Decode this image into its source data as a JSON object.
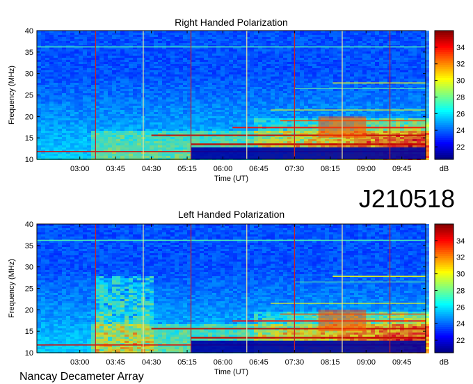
{
  "chart_data": [
    {
      "type": "heatmap",
      "title": "Right Handed Polarization",
      "xlabel": "Time (UT)",
      "ylabel": "Frequency (MHz)",
      "x_tick_labels": [
        "03:00",
        "03:45",
        "04:30",
        "05:15",
        "06:00",
        "06:45",
        "07:30",
        "08:15",
        "09:00",
        "09:45"
      ],
      "x_ticks_hours": [
        3.0,
        3.75,
        4.5,
        5.25,
        6.0,
        6.75,
        7.5,
        8.25,
        9.0,
        9.75
      ],
      "xlim_hours": [
        2.1,
        10.25
      ],
      "ylim": [
        10,
        40
      ],
      "y_ticks": [
        10,
        15,
        20,
        25,
        30,
        35,
        40
      ],
      "colorbar": {
        "label": "dB",
        "ticks": [
          22,
          24,
          26,
          28,
          30,
          32,
          34
        ],
        "range": [
          20.5,
          36
        ]
      },
      "vertical_markers_hours": [
        3.33,
        4.33,
        5.33,
        6.5,
        7.5,
        8.5,
        9.5
      ],
      "emission_features": [
        {
          "desc": "persistent interference line",
          "freq_mhz": 36,
          "level_db": 27
        },
        {
          "desc": "low-frequency band activity",
          "freq_mhz": [
            10,
            20
          ],
          "time_hours": [
            7.0,
            10.25
          ],
          "level_db": 33
        },
        {
          "desc": "drifting burst",
          "freq_mhz": [
            17,
            24
          ],
          "time_hours": [
            6.5,
            6.9
          ],
          "level_db": 32
        }
      ]
    },
    {
      "type": "heatmap",
      "title": "Left Handed Polarization",
      "xlabel": "Time (UT)",
      "ylabel": "Frequency (MHz)",
      "x_tick_labels": [
        "03:00",
        "03:45",
        "04:30",
        "05:15",
        "06:00",
        "06:45",
        "07:30",
        "08:15",
        "09:00",
        "09:45"
      ],
      "x_ticks_hours": [
        3.0,
        3.75,
        4.5,
        5.25,
        6.0,
        6.75,
        7.5,
        8.25,
        9.0,
        9.75
      ],
      "xlim_hours": [
        2.1,
        10.25
      ],
      "ylim": [
        10,
        40
      ],
      "y_ticks": [
        10,
        15,
        20,
        25,
        30,
        35,
        40
      ],
      "colorbar": {
        "label": "dB",
        "ticks": [
          22,
          24,
          26,
          28,
          30,
          32,
          34
        ],
        "range": [
          20.5,
          36
        ]
      },
      "vertical_markers_hours": [
        3.33,
        4.33,
        5.33,
        6.5,
        7.5,
        8.5,
        9.5
      ],
      "emission_features": [
        {
          "desc": "persistent interference line",
          "freq_mhz": 36,
          "level_db": 27
        },
        {
          "desc": "low-frequency band activity",
          "freq_mhz": [
            10,
            20
          ],
          "time_hours": [
            7.0,
            10.25
          ],
          "level_db": 33
        },
        {
          "desc": "broadband vertical striations",
          "freq_mhz": [
            10,
            30
          ],
          "time_hours": [
            3.3,
            4.5
          ],
          "level_db": 28
        }
      ]
    }
  ],
  "observation_id": "J210518",
  "footer_text": "Nancay Decameter Array"
}
